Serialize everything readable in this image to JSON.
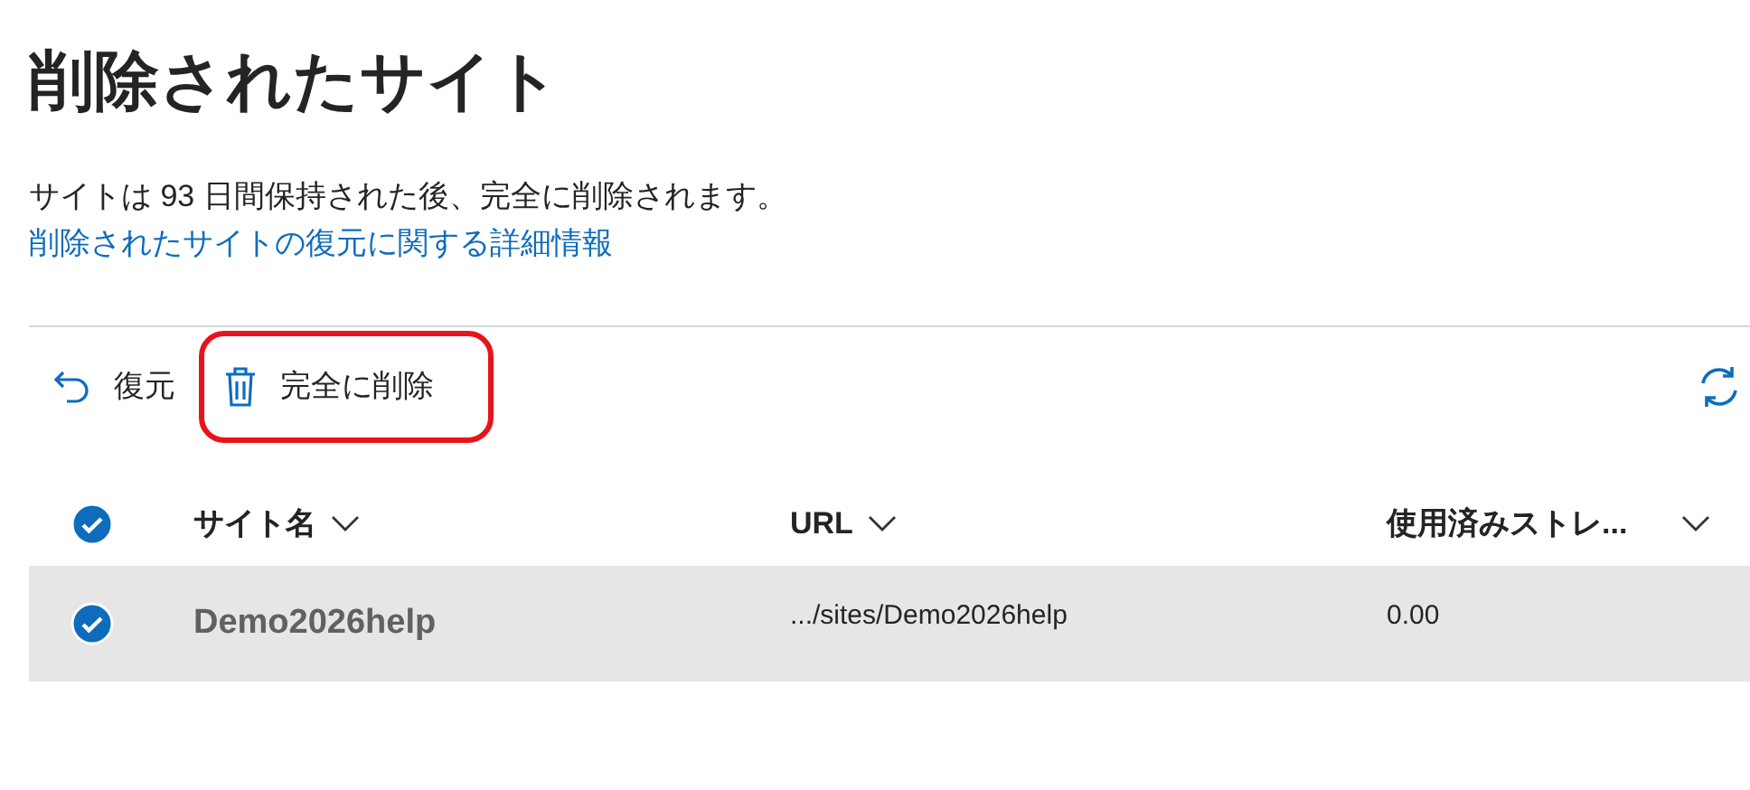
{
  "title": "削除されたサイト",
  "description": "サイトは 93 日間保持された後、完全に削除されます。",
  "help_link": "削除されたサイトの復元に関する詳細情報",
  "toolbar": [
    {
      "kind": "restore",
      "label": "復元",
      "highlighted": false
    },
    {
      "kind": "delete",
      "label": "完全に削除",
      "highlighted": true
    }
  ],
  "table": {
    "all_selected": true,
    "columns": [
      "サイト名",
      "URL",
      "使用済みストレ..."
    ],
    "rows": [
      {
        "selected": true,
        "cells": [
          "Demo2026help",
          ".../sites/Demo2026help",
          "0.00"
        ]
      }
    ]
  }
}
